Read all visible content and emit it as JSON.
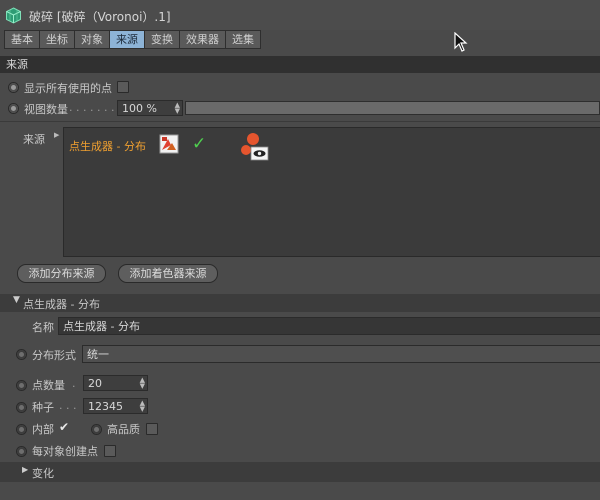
{
  "window": {
    "title": "破碎 [破碎（Voronoi）.1]",
    "icon": "voronoi-cube-icon",
    "icon_color": "#3fb98a"
  },
  "tabs": [
    {
      "label": "基本",
      "active": false
    },
    {
      "label": "坐标",
      "active": false
    },
    {
      "label": "对象",
      "active": false
    },
    {
      "label": "来源",
      "active": true
    },
    {
      "label": "变换",
      "active": false
    },
    {
      "label": "效果器",
      "active": false
    },
    {
      "label": "选集",
      "active": false
    }
  ],
  "section_title": "来源",
  "show_all_points": {
    "label": "显示所有使用的点",
    "checked": false
  },
  "viewport_count": {
    "label": "视图数量",
    "dots": ". . . . . . .",
    "value": "100 %",
    "level": 0.0
  },
  "sources": {
    "label": "来源",
    "items": [
      {
        "name": "点生成器 - 分布",
        "name_color": "#f0a030",
        "enabled_mark": "✓"
      }
    ]
  },
  "buttons": {
    "add_distribution": "添加分布来源",
    "add_shader": "添加着色器来源"
  },
  "generator": {
    "header": "点生成器 - 分布",
    "name_label": "名称",
    "name_value": "点生成器 - 分布",
    "distribution_label": "分布形式",
    "distribution_value": "统一",
    "point_count_label": "点数量",
    "point_count_dots": ".",
    "point_count_value": "20",
    "seed_label": "种子",
    "seed_dots": ". . .",
    "seed_value": "12345",
    "inside_label": "内部",
    "inside_checked": true,
    "high_quality_label": "高品质",
    "high_quality_checked": false,
    "per_object_label": "每对象创建点",
    "per_object_checked": false
  },
  "transform_section": {
    "label": "变化"
  }
}
